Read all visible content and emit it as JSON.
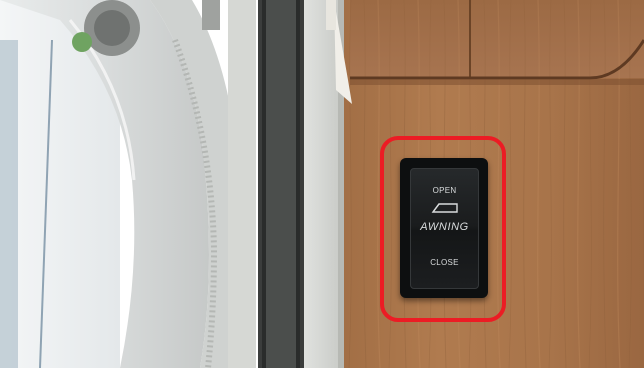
{
  "switch": {
    "open_label": "OPEN",
    "name_label": "AWNING",
    "close_label": "CLOSE",
    "icon": "awning-icon"
  },
  "highlight": {
    "color": "#ec1c24"
  }
}
